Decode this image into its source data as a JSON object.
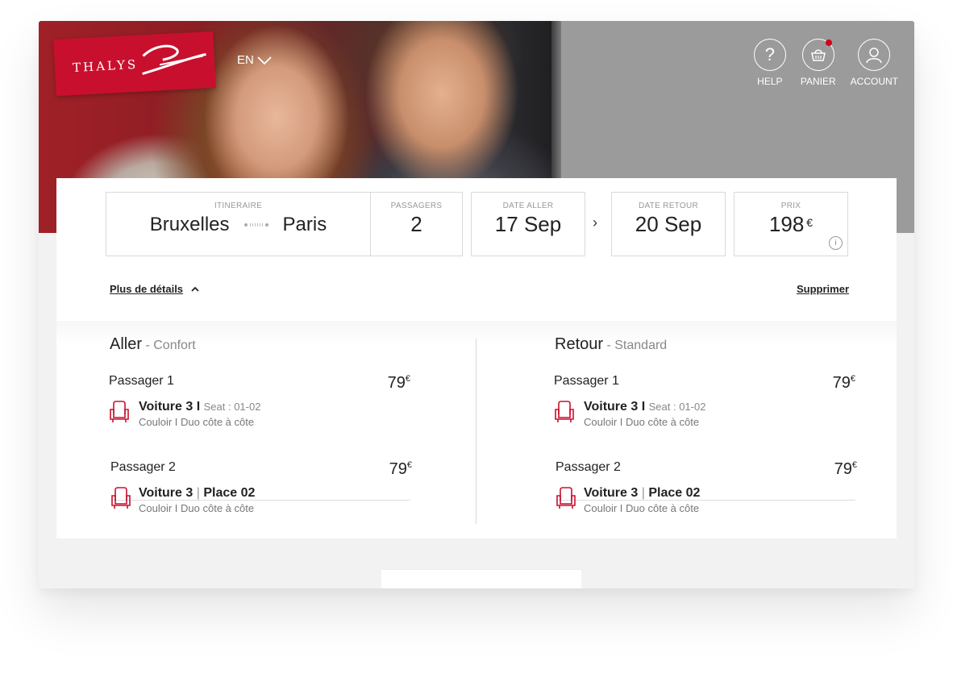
{
  "header": {
    "logo_text": "THALYS",
    "language": "EN",
    "nav": [
      {
        "id": "help",
        "label": "HELP",
        "icon": "question-icon"
      },
      {
        "id": "panier",
        "label": "PANIER",
        "icon": "basket-icon"
      },
      {
        "id": "account",
        "label": "ACCOUNT",
        "icon": "user-icon"
      }
    ]
  },
  "summary": {
    "itinerary_label": "ITINERAIRE",
    "from": "Bruxelles",
    "to": "Paris",
    "passengers_label": "PASSAGERS",
    "passengers": "2",
    "date_out_label": "DATE ALLER",
    "date_out": "17 Sep",
    "date_ret_label": "DATE RETOUR",
    "date_ret": "20 Sep",
    "price_label": "PRIX",
    "price": "198",
    "currency": "€"
  },
  "actions": {
    "details": "Plus de détails",
    "delete": "Supprimer"
  },
  "outbound": {
    "title": "Aller",
    "class": "Confort",
    "passengers": [
      {
        "name": "Passager 1",
        "price": "79",
        "currency": "€",
        "car": "Voiture 3 I",
        "seat": "Seat : 01-02",
        "detail": "Couloir I Duo côte à côte"
      },
      {
        "name": "Passager 2",
        "price": "79",
        "currency": "€",
        "car": "Voiture 3",
        "place": "Place 02",
        "detail": "Couloir I Duo côte à côte"
      }
    ]
  },
  "return": {
    "title": "Retour",
    "class": "Standard",
    "passengers": [
      {
        "name": "Passager 1",
        "price": "79",
        "currency": "€",
        "car": "Voiture 3 I",
        "seat": "Seat : 01-02",
        "detail": "Couloir I Duo côte à côte"
      },
      {
        "name": "Passager 2",
        "price": "79",
        "currency": "€",
        "car": "Voiture 3",
        "place": "Place 02",
        "detail": "Couloir I Duo côte à côte"
      }
    ]
  },
  "colors": {
    "brand_red": "#c8102e",
    "header_gray": "#9b9b9b",
    "seat_red": "#c8102e"
  }
}
